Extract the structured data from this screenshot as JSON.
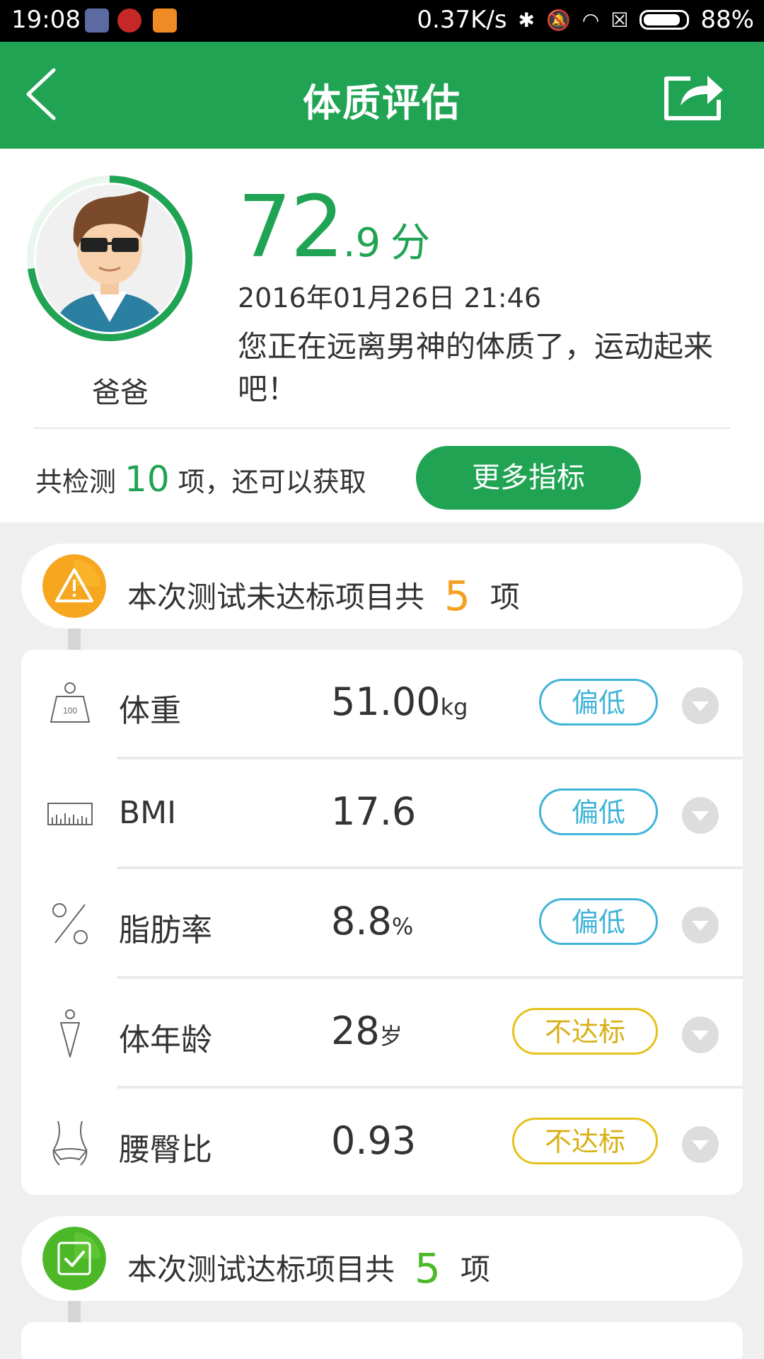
{
  "status_bar": {
    "time": "19:08",
    "net_speed": "0.37K/s",
    "battery": "88%",
    "battery_level": 0.88
  },
  "header": {
    "title": "体质评估"
  },
  "summary": {
    "score_int": "72",
    "score_dec": ".9",
    "score_unit": "分",
    "score_progress": 0.729,
    "date": "2016年01月26日 21:46",
    "message": "您正在远离男神的体质了，运动起来吧！",
    "user_name": "爸爸",
    "detect_prefix": "共检测",
    "detect_count": "10",
    "detect_suffix": "项，还可以获取",
    "more_button": "更多指标"
  },
  "failed_section": {
    "prefix": "本次测试未达标项目共",
    "count": "5",
    "suffix": "项",
    "color": "#f5a020"
  },
  "metrics": [
    {
      "icon": "weight-icon",
      "label": "体重",
      "value": "51.00",
      "unit": "kg",
      "status": "偏低",
      "status_type": "low"
    },
    {
      "icon": "bmi-icon",
      "label": "BMI",
      "value": "17.6",
      "unit": "",
      "status": "偏低",
      "status_type": "low"
    },
    {
      "icon": "percent-icon",
      "label": "脂肪率",
      "value": "8.8",
      "unit": "%",
      "status": "偏低",
      "status_type": "low"
    },
    {
      "icon": "body-age-icon",
      "label": "体年龄",
      "value": "28",
      "unit": "岁",
      "status": "不达标",
      "status_type": "fail"
    },
    {
      "icon": "waist-hip-icon",
      "label": "腰臀比",
      "value": "0.93",
      "unit": "",
      "status": "不达标",
      "status_type": "fail"
    }
  ],
  "passed_section": {
    "prefix": "本次测试达标项目共",
    "count": "5",
    "suffix": "项",
    "color": "#4cb828"
  },
  "colors": {
    "brand_green": "#21a354",
    "low_blue": "#3fb3d8",
    "fail_yellow": "#e6c21b"
  }
}
